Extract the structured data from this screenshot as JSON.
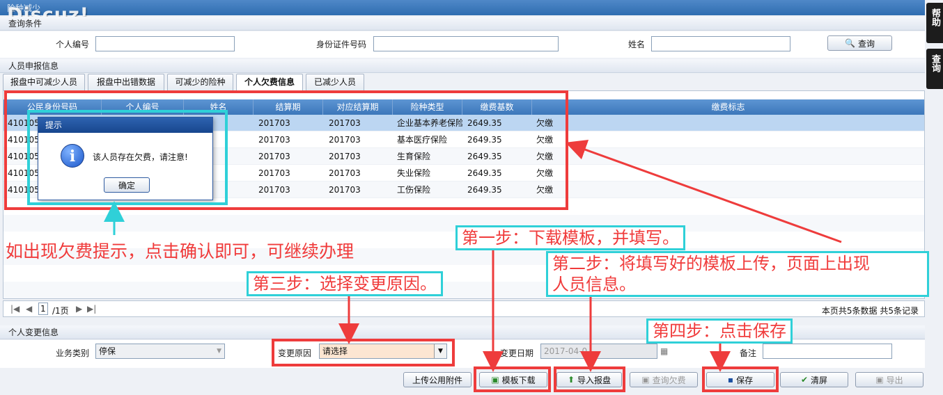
{
  "app": {
    "title": "险种减少",
    "logo": "Discuz!"
  },
  "side_tabs": [
    "帮助",
    "查询"
  ],
  "query_section": {
    "title": "查询条件",
    "fields": [
      {
        "label": "个人编号",
        "value": ""
      },
      {
        "label": "身份证件号码",
        "value": ""
      },
      {
        "label": "姓名",
        "value": ""
      }
    ],
    "query_button": "查询"
  },
  "report_section": {
    "title": "人员申报信息"
  },
  "tabs": [
    {
      "label": "报盘中可减少人员",
      "active": false
    },
    {
      "label": "报盘中出错数据",
      "active": false
    },
    {
      "label": "可减少的险种",
      "active": false
    },
    {
      "label": "个人欠费信息",
      "active": true
    },
    {
      "label": "已减少人员",
      "active": false
    }
  ],
  "grid": {
    "columns": [
      "公民身份号码",
      "个人编号",
      "姓名",
      "结算期",
      "对应结算期",
      "险种类型",
      "缴费基数",
      "缴费标志"
    ],
    "rows": [
      {
        "id": "410105",
        "no": "",
        "name": "",
        "period": "201703",
        "mapped_period": "201703",
        "type": "企业基本养老保险",
        "base": "2649.35",
        "flag": "欠缴"
      },
      {
        "id": "410105",
        "no": "",
        "name": "",
        "period": "201703",
        "mapped_period": "201703",
        "type": "基本医疗保险",
        "base": "2649.35",
        "flag": "欠缴"
      },
      {
        "id": "410105",
        "no": "",
        "name": "",
        "period": "201703",
        "mapped_period": "201703",
        "type": "生育保险",
        "base": "2649.35",
        "flag": "欠缴"
      },
      {
        "id": "410105",
        "no": "",
        "name": "",
        "period": "201703",
        "mapped_period": "201703",
        "type": "失业保险",
        "base": "2649.35",
        "flag": "欠缴"
      },
      {
        "id": "410105",
        "no": "",
        "name": "",
        "period": "201703",
        "mapped_period": "201703",
        "type": "工伤保险",
        "base": "2649.35",
        "flag": "欠缴"
      }
    ]
  },
  "pager": {
    "page": "1",
    "total": "/1页",
    "summary": "本页共5条数据 共5条记录"
  },
  "dialog": {
    "title": "提示",
    "message": "该人员存在欠费，请注意!",
    "ok": "确定"
  },
  "change_section": {
    "title": "个人变更信息",
    "business_type_label": "业务类别",
    "business_type_value": "停保",
    "reason_label": "变更原因",
    "reason_value": "请选择",
    "date_label": "变更日期",
    "date_value": "2017-04-0",
    "remark_label": "备注",
    "remark_value": ""
  },
  "buttons": [
    {
      "label": "上传公用附件",
      "enabled": true
    },
    {
      "label": "模板下载",
      "enabled": true
    },
    {
      "label": "导入报盘",
      "enabled": true
    },
    {
      "label": "查询欠费",
      "enabled": false
    },
    {
      "label": "保存",
      "enabled": true
    },
    {
      "label": "清屏",
      "enabled": true
    },
    {
      "label": "导出",
      "enabled": false
    }
  ],
  "annotations": {
    "tip": "如出现欠费提示，点击确认即可，可继续办理",
    "step1": "第一步：下载模板，并填写。",
    "step2_line1": "第二步：将填写好的模板上传，页面上出现",
    "step2_line2": "人员信息。",
    "step3": "第三步：选择变更原因。",
    "step4": "第四步：点击保存"
  },
  "colors": {
    "annotation_red": "#ee3c3c",
    "annotation_cyan": "#2fd0d8",
    "header_blue": "#3c77ba"
  }
}
